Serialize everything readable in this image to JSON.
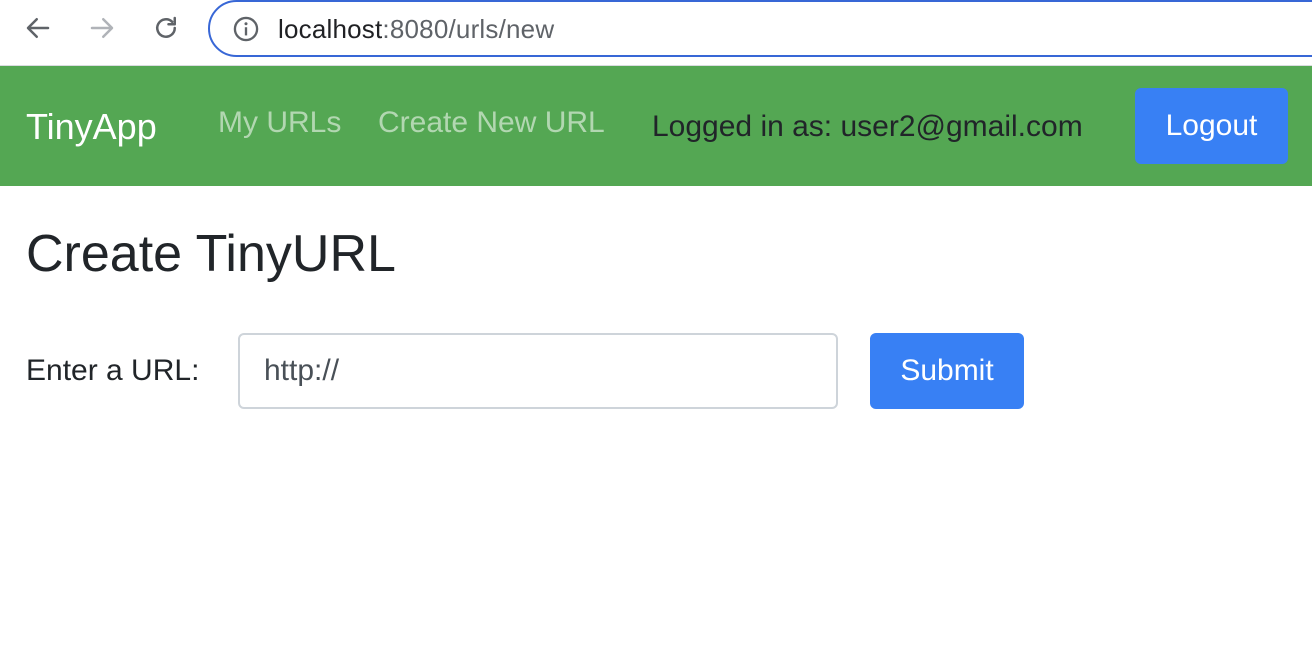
{
  "browser": {
    "url_host": "localhost",
    "url_rest": ":8080/urls/new",
    "icons": {
      "back": "arrow-left-icon",
      "forward": "arrow-right-icon",
      "reload": "reload-icon",
      "info": "info-icon"
    }
  },
  "navbar": {
    "brand": "TinyApp",
    "links": [
      {
        "label": "My URLs"
      },
      {
        "label": "Create New URL"
      }
    ],
    "logged_in_text": "Logged in as: user2@gmail.com",
    "logout_label": "Logout",
    "colors": {
      "background": "#54a753",
      "button": "#3880f4"
    }
  },
  "main": {
    "title": "Create TinyURL",
    "form": {
      "label": "Enter a URL:",
      "input_value": "http://",
      "submit_label": "Submit"
    }
  }
}
